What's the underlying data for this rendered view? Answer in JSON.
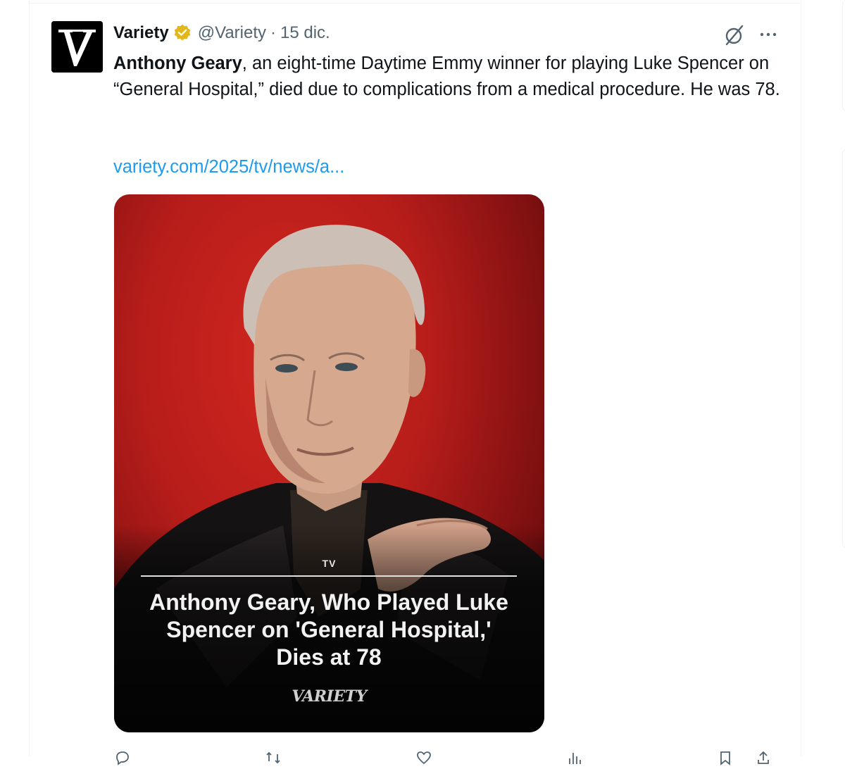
{
  "tweet": {
    "author_name": "Variety",
    "verified_badge_icon": "verified-gold-badge-icon",
    "handle": "@Variety",
    "separator": "·",
    "date": "15 dic.",
    "body_bold": "Anthony Geary",
    "body_rest": ", an eight-time Daytime Emmy winner for playing Luke Spencer on “General Hospital,” died due to complications from a medical procedure. He was 78.",
    "link_text": "variety.com/2025/tv/news/a...",
    "colors": {
      "link": "#1d9bf0",
      "muted": "#536471",
      "badge": "#e2b719"
    }
  },
  "card": {
    "tag": "TV",
    "headline": "Anthony Geary, Who Played Luke Spencer on 'General Hospital,' Dies at 78",
    "brand": "VARIETY",
    "background_color": "#c0201c"
  },
  "icons": {
    "avatar": "variety-v-logo",
    "grok": "grok-icon",
    "more": "more-horizontal-icon",
    "actions": [
      "reply-icon",
      "retweet-icon",
      "like-icon",
      "views-icon",
      "bookmark-icon",
      "share-icon"
    ]
  }
}
